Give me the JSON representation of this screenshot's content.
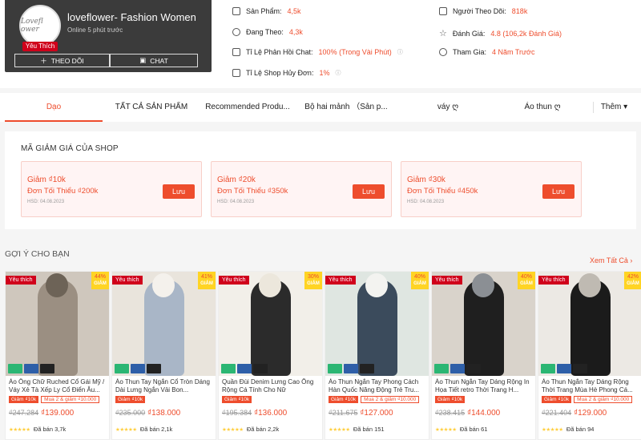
{
  "shop": {
    "name": "loveflower- Fashion Women",
    "avatar_text": "Lovefl ower",
    "online": "Online 5 phút trước",
    "fav_badge": "Yêu Thích",
    "follow": "THEO DÕI",
    "chat": "CHAT"
  },
  "stats": {
    "products_label": "Sản Phẩm:",
    "products": "4,5k",
    "following_label": "Đang Theo:",
    "following": "4,3k",
    "chat_label": "Tỉ Lệ Phản Hồi Chat:",
    "chat": "100% (Trong Vài Phút)",
    "cancel_label": "Tỉ Lệ Shop Hủy Đơn:",
    "cancel": "1%",
    "followers_label": "Người Theo Dõi:",
    "followers": "818k",
    "rating_label": "Đánh Giá:",
    "rating": "4.8 (106,2k Đánh Giá)",
    "joined_label": "Tham Gia:",
    "joined": "4 Năm Trước"
  },
  "tabs": [
    "Dạo",
    "TẤT CẢ SẢN PHẨM",
    "Recommended Produ...",
    "Bộ hai mảnh （Sản p...",
    "váy ღ",
    "Áo thun ღ",
    "Thêm ▾"
  ],
  "vouchers": {
    "title": "MÃ GIẢM GIÁ CỦA SHOP",
    "items": [
      {
        "discount": "Giảm ₫10k",
        "min": "Đơn Tối Thiểu ₫200k",
        "exp": "HSD: 04.08.2023",
        "btn": "Lưu"
      },
      {
        "discount": "Giảm ₫20k",
        "min": "Đơn Tối Thiểu ₫350k",
        "exp": "HSD: 04.08.2023",
        "btn": "Lưu"
      },
      {
        "discount": "Giảm ₫30k",
        "min": "Đơn Tối Thiểu ₫450k",
        "exp": "HSD: 04.08.2023",
        "btn": "Lưu"
      }
    ]
  },
  "suggest": {
    "title": "GỢI Ý CHO BẠN",
    "see_all": "Xem Tất Cả ›"
  },
  "products": [
    {
      "fav": "Yêu thích",
      "disc": "44%",
      "disc_label": "GIẢM",
      "name": "Áo Ông Chữ Ruched Cổ Gái Mỹ / Váy Xẻ Tà Xếp Ly Cổ Điển Âu...",
      "tag1": "Giảm ₫10k",
      "tag2": "Mua 2 & giảm ₫10.000",
      "old": "₫247.284",
      "new": "₫139.000",
      "sold": "Đã bán 3,7k",
      "stars": "★★★★★"
    },
    {
      "fav": "Yêu thích",
      "disc": "41%",
      "disc_label": "GIẢM",
      "name": "Áo Thun Tay Ngắn Cổ Tròn Dáng Dài Lưng Ngắn Vải Bon...",
      "tag1": "Giảm ₫10k",
      "tag2": "",
      "old": "₫235.000",
      "new": "₫138.000",
      "sold": "Đã bán 2,1k",
      "stars": "★★★★★"
    },
    {
      "fav": "Yêu thích",
      "disc": "30%",
      "disc_label": "GIẢM",
      "name": "Quần Đùi Denim Lưng Cao Ống Rộng Cá Tính Cho Nữ",
      "tag1": "Giảm ₫10k",
      "tag2": "",
      "old": "₫195.384",
      "new": "₫136.000",
      "sold": "Đã bán 2,2k",
      "stars": "★★★★★"
    },
    {
      "fav": "Yêu thích",
      "disc": "40%",
      "disc_label": "GIẢM",
      "name": "Áo Thun Ngắn Tay Phong Cách Hàn Quốc Năng Động Trẻ Tru...",
      "tag1": "Giảm ₫10k",
      "tag2": "Mua 2 & giảm ₫10.000",
      "old": "₫211.675",
      "new": "₫127.000",
      "sold": "Đã bán 151",
      "stars": "★★★★★"
    },
    {
      "fav": "Yêu thích",
      "disc": "40%",
      "disc_label": "GIẢM",
      "name": "Áo Thun Ngắn Tay Dáng Rộng In Họa Tiết retro Thời Trang H...",
      "tag1": "Giảm ₫10k",
      "tag2": "",
      "old": "₫238.415",
      "new": "₫144.000",
      "sold": "Đã bán 61",
      "stars": "★★★★★"
    },
    {
      "fav": "Yêu thích",
      "disc": "42%",
      "disc_label": "GIẢM",
      "name": "Áo Thun Ngắn Tay Dáng Rộng Thời Trang Mùa Hè Phong Cá...",
      "tag1": "Giảm ₫10k",
      "tag2": "Mua 2 & giảm ₫10.000",
      "old": "₫221.404",
      "new": "₫129.000",
      "sold": "Đã bán 94",
      "stars": "★★★★★"
    }
  ],
  "colors": {
    "accent": "#ee4d2d",
    "fav": "#d0011b",
    "discount_bg": "#ffd424"
  }
}
